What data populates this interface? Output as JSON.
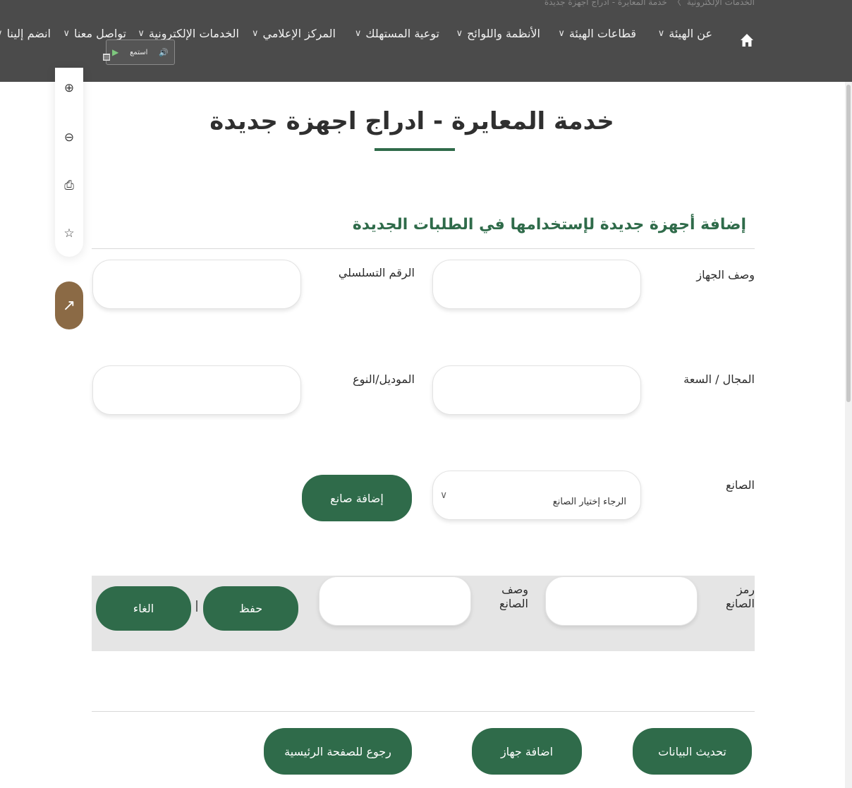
{
  "breadcrumb": {
    "items": [
      "الخدمات الإلكترونية",
      "خدمة المعايرة - ادراج اجهزة جديدة"
    ],
    "separator": "〉"
  },
  "nav": {
    "items": [
      {
        "label": "عن الهيئة",
        "chev": "∨"
      },
      {
        "label": "قطاعات الهيئة",
        "chev": "∨"
      },
      {
        "label": "الأنظمة واللوائح",
        "chev": "∨"
      },
      {
        "label": "توعية المستهلك",
        "chev": "∨"
      },
      {
        "label": "المركز الإعلامي",
        "chev": "∨"
      },
      {
        "label": "الخدمات الإلكترونية",
        "chev": "∨"
      },
      {
        "label": "تواصل معنا",
        "chev": "∨"
      },
      {
        "label": "انضم إلينا",
        "chev": "∨"
      }
    ]
  },
  "audio": {
    "label": "استمع",
    "speaker": "🔊",
    "play": "▶",
    "menu": "≡"
  },
  "rail": {
    "zoom_in": "⊕",
    "zoom_out": "⊖",
    "print": "⎙",
    "favorite": "☆",
    "share": "↗"
  },
  "page": {
    "title": "خدمة المعايرة - ادراج اجهزة جديدة",
    "section_title": "إضافة أجهزة جديدة لإستخدامها في الطلبات الجديدة"
  },
  "form": {
    "device_desc_label": "وصف الجهاز",
    "serial_label": "الرقم التسلسلي",
    "range_label": "المجال / السعة",
    "model_label": "الموديل/النوع",
    "maker_label": "الصانع",
    "maker_select_placeholder": "الرجاء إختيار الصانع",
    "maker_select_chev": "∨",
    "add_maker_button": "إضافة صانع"
  },
  "maker_panel": {
    "code_label_line1": "رمز",
    "code_label_line2": "الصانع",
    "desc_label_line1": "وصف",
    "desc_label_line2": "الصانع",
    "save_button": "حفظ",
    "cancel_button": "الغاء"
  },
  "footer_buttons": {
    "update": "تحديث البيانات",
    "add_device": "اضافة جهاز",
    "back_home": "رجوع للصفحة الرئيسية"
  },
  "colors": {
    "nav_bg": "#4b4b4b",
    "accent_green": "#2f6b4a",
    "share_brown": "#8b6a45",
    "panel_gray": "#e5e5e5"
  }
}
